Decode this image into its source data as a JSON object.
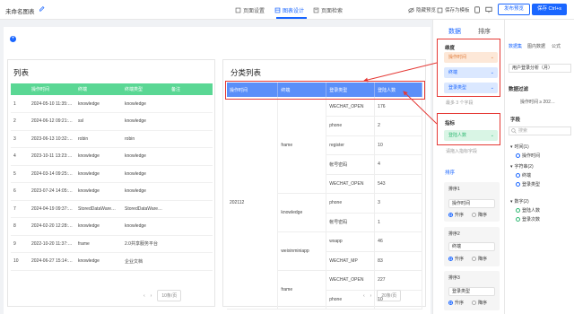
{
  "header": {
    "title": "未命名图表",
    "tabs": [
      {
        "label": "页面设置",
        "icon": "page-settings-icon"
      },
      {
        "label": "图表设计",
        "icon": "chart-design-icon"
      },
      {
        "label": "页面检索",
        "icon": "page-search-icon"
      }
    ],
    "actions": [
      {
        "label": "隐藏预览",
        "icon": "eye-hidden-icon"
      },
      {
        "label": "保存为模板",
        "icon": "template-icon"
      }
    ],
    "publish_label": "发布预览",
    "save_label": "保存 Ctrl+s"
  },
  "list_card": {
    "title": "列表",
    "columns": [
      "",
      "操作时间",
      "终端",
      "终端类型",
      "备注"
    ],
    "rows": [
      [
        "1",
        "2024-05-10 11:35:…",
        "knowledge",
        "knowledge",
        ""
      ],
      [
        "2",
        "2024-06-12 09:21:…",
        "ssl",
        "knowledge",
        ""
      ],
      [
        "3",
        "2023-06-13 10:32:…",
        "robin",
        "robin",
        ""
      ],
      [
        "4",
        "2023-10-11 13:23:…",
        "knowledge",
        "knowledge",
        ""
      ],
      [
        "5",
        "2024-03-14 09:25:…",
        "knowledge",
        "knowledge",
        ""
      ],
      [
        "6",
        "2023-07-24 14:05:…",
        "knowledge",
        "knowledge",
        ""
      ],
      [
        "7",
        "2024-04-19 09:37:…",
        "StoredDataWare…",
        "StoredDataWare…",
        ""
      ],
      [
        "8",
        "2024-02-20 12:28:…",
        "knowledge",
        "knowledge",
        ""
      ],
      [
        "9",
        "2022-10-20 11:37:…",
        "frame",
        "2.0共享服务平台",
        ""
      ],
      [
        "10",
        "2024-06-27 15:14:…",
        "knowledge",
        "企业文档",
        ""
      ]
    ],
    "page_size": "10条/页"
  },
  "group_card": {
    "title": "分类列表",
    "columns": [
      "操作时间",
      "终端",
      "登录类型",
      "登陆人数"
    ],
    "time_value": "202112",
    "group_frame": "frame",
    "group_knowledge": "knowledge",
    "group_weixin": "weixinminiapp",
    "group_frame2": "frame",
    "rows": [
      {
        "type": "WECHAT_OPEN",
        "count": "176"
      },
      {
        "type": "phone",
        "count": "2"
      },
      {
        "type": "register",
        "count": "10"
      },
      {
        "type": "帐号密码",
        "count": "4"
      },
      {
        "type": "WECHAT_OPEN",
        "count": "543"
      },
      {
        "type": "phone",
        "count": "3"
      },
      {
        "type": "帐号密码",
        "count": "1"
      },
      {
        "type": "wxapp",
        "count": "46"
      },
      {
        "type": "WECHAT_MP",
        "count": "83"
      },
      {
        "type": "WECHAT_OPEN",
        "count": "227"
      },
      {
        "type": "phone",
        "count": "10"
      }
    ],
    "page_size": "20条/页"
  },
  "config_panel": {
    "tabs": [
      "数据",
      "排序",
      "样式",
      "交互"
    ],
    "dimension_label": "维度",
    "dimension_pills": [
      "操作时间",
      "终端",
      "登录类型"
    ],
    "dimension_hint": "最多 3 个字段",
    "metric_label": "指标",
    "metric_pills": [
      "登陆人数"
    ],
    "metric_hint": "请拖入指标字段",
    "sort_label": "排序",
    "sorts": [
      {
        "title": "排序1",
        "field": "操作时间",
        "asc": "升序",
        "desc": "降序"
      },
      {
        "title": "排序2",
        "field": "终端",
        "asc": "升序",
        "desc": "降序"
      },
      {
        "title": "排序3",
        "field": "登录类型",
        "asc": "升序",
        "desc": "降序"
      }
    ]
  },
  "source_panel": {
    "tabs": [
      "数据集",
      "图内数据",
      "公式"
    ],
    "dataset": "用户登录分析（月）",
    "filter_label": "数据过滤",
    "filter_value": "操作时间 ≥ 202…",
    "field_label": "字段",
    "search_placeholder": "搜索",
    "tree": [
      {
        "label": "时间(1)",
        "children": [
          "操作时间"
        ]
      },
      {
        "label": "字符串(2)",
        "children": [
          "终端",
          "登录类型"
        ]
      },
      {
        "label": "数字(2)",
        "children": [
          "登陆人数",
          "登录次数"
        ]
      }
    ]
  },
  "colors": {
    "accent": "#1a66ff",
    "list_header": "#5ad794",
    "group_header": "#5b8ff9",
    "annotation": "#e53935"
  }
}
